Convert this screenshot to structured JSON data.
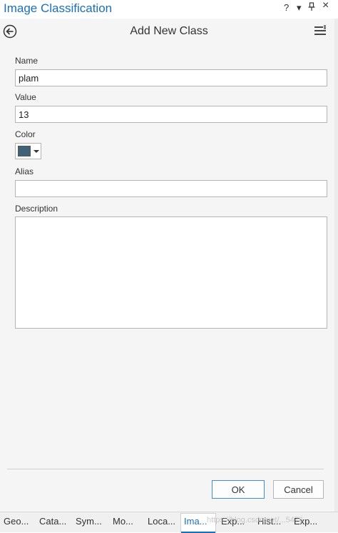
{
  "pane": {
    "title": "Image Classification",
    "help_label": "?",
    "dropdown_label": "▾",
    "pin_label": "↕",
    "close_label": "×"
  },
  "header": {
    "title": "Add New Class"
  },
  "form": {
    "name_label": "Name",
    "name_value": "plam",
    "value_label": "Value",
    "value_value": "13",
    "color_label": "Color",
    "color_value": "#3f6277",
    "alias_label": "Alias",
    "alias_value": "",
    "description_label": "Description",
    "description_value": ""
  },
  "buttons": {
    "ok_label": "OK",
    "cancel_label": "Cancel"
  },
  "bottom_tabs": [
    {
      "label": "Geo..."
    },
    {
      "label": "Cata..."
    },
    {
      "label": "Sym..."
    },
    {
      "label": "Mo..."
    },
    {
      "label": "Loca..."
    },
    {
      "label": "Ima..."
    },
    {
      "label": "Exp..."
    },
    {
      "label": "Hist..."
    },
    {
      "label": "Exp..."
    }
  ],
  "watermark": "https://blog.csdn.net/...5476",
  "colors": {
    "accent": "#1b6fb8",
    "panel_background": "#f5f5f5",
    "ok_border": "#3c8ee0"
  }
}
